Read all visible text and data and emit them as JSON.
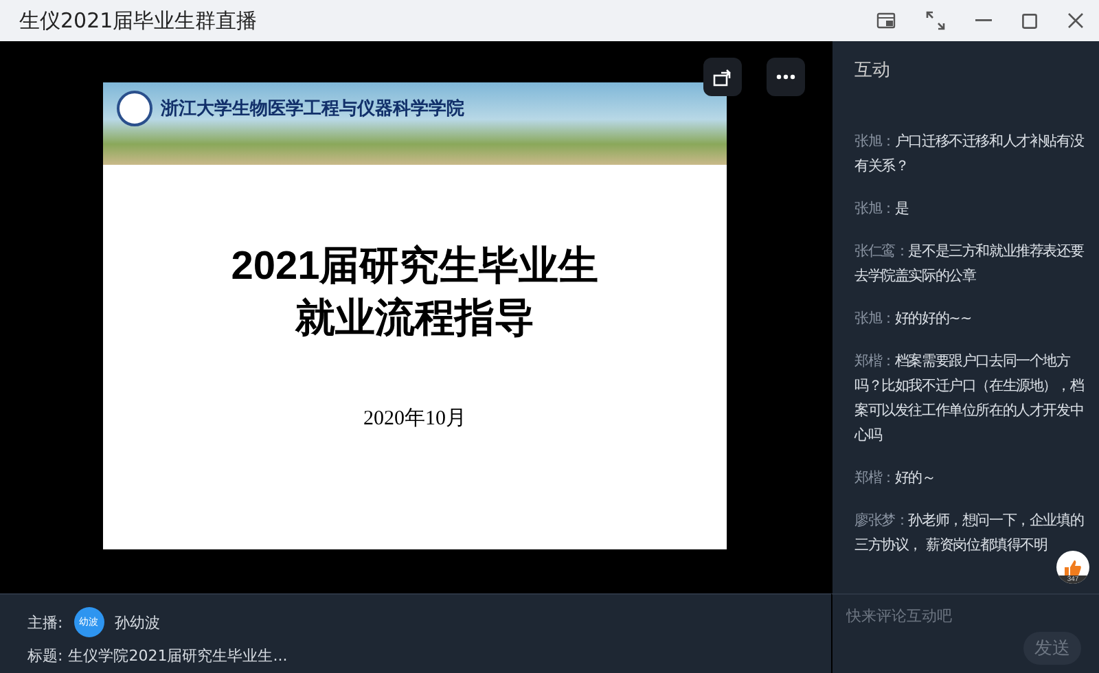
{
  "window": {
    "title": "生仪2021届毕业生群直播"
  },
  "slide": {
    "banner_title": "浙江大学生物医学工程与仪器科学学院",
    "title_lines": [
      "2021届研究生毕业生",
      "就业流程指导"
    ],
    "date": "2020年10月"
  },
  "chat": {
    "title": "互动",
    "messages": [
      {
        "author": "张旭：",
        "text": "户口迁移不迁移和人才补贴有没有关系？"
      },
      {
        "author": "张旭：",
        "text": "是"
      },
      {
        "author": "张仁鸾：",
        "text": "是不是三方和就业推荐表还要去学院盖实际的公章"
      },
      {
        "author": "张旭：",
        "text": "好的好的~~"
      },
      {
        "author": "郑楷：",
        "text": "档案需要跟户口去同一个地方吗？比如我不迁户口（在生源地），档案可以发往工作单位所在的人才开发中心吗"
      },
      {
        "author": "郑楷：",
        "text": "好的～"
      },
      {
        "author": "廖张梦：",
        "text": "孙老师，想问一下，企业填的三方协议， 薪资岗位都填得不明"
      }
    ],
    "likes": "347",
    "input": {
      "placeholder": "快来评论互动吧"
    },
    "send": "发送"
  },
  "footer": {
    "host_label": "主播:",
    "host_avatar": "幼波",
    "host_name": "孙幼波",
    "title_label": "标题:",
    "title": "生仪学院2021届研究生毕业生..."
  }
}
